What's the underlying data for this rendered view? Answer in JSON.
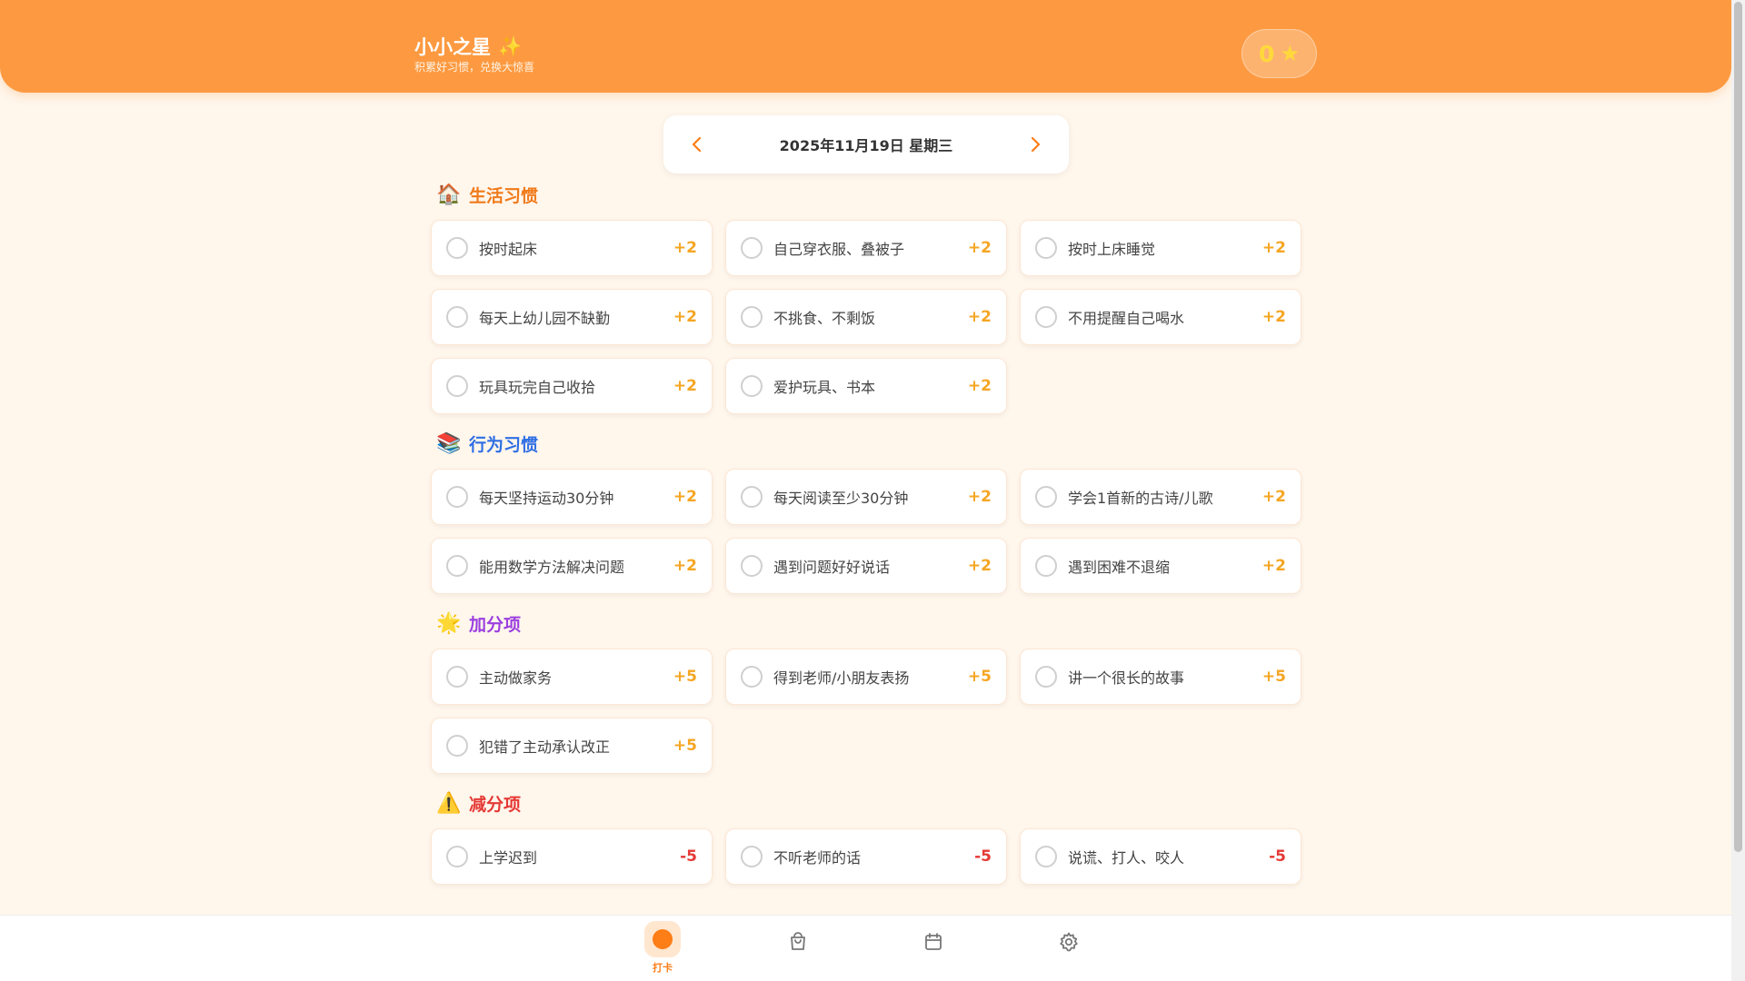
{
  "header": {
    "title": "小小之星",
    "title_icon": "sparkles-icon",
    "subtitle": "积累好习惯，兑换大惊喜",
    "score": "0",
    "score_icon": "star-icon"
  },
  "date_nav": {
    "date": "2025年11月19日 星期三",
    "prev_icon": "chevron-left-icon",
    "next_icon": "chevron-right-icon"
  },
  "sections": [
    {
      "key": "life",
      "icon": "🏠",
      "icon_name": "house-icon",
      "title": "生活习惯",
      "color": "#f07a1a",
      "items": [
        {
          "name": "按时起床",
          "points": "+2"
        },
        {
          "name": "自己穿衣服、叠被子",
          "points": "+2"
        },
        {
          "name": "按时上床睡觉",
          "points": "+2"
        },
        {
          "name": "每天上幼儿园不缺勤",
          "points": "+2"
        },
        {
          "name": "不挑食、不剩饭",
          "points": "+2"
        },
        {
          "name": "不用提醒自己喝水",
          "points": "+2"
        },
        {
          "name": "玩具玩完自己收拾",
          "points": "+2"
        },
        {
          "name": "爱护玩具、书本",
          "points": "+2"
        }
      ]
    },
    {
      "key": "behavior",
      "icon": "📚",
      "icon_name": "books-icon",
      "title": "行为习惯",
      "color": "#2f6fe4",
      "items": [
        {
          "name": "每天坚持运动30分钟",
          "points": "+2"
        },
        {
          "name": "每天阅读至少30分钟",
          "points": "+2"
        },
        {
          "name": "学会1首新的古诗/儿歌",
          "points": "+2"
        },
        {
          "name": "能用数学方法解决问题",
          "points": "+2"
        },
        {
          "name": "遇到问题好好说话",
          "points": "+2"
        },
        {
          "name": "遇到困难不退缩",
          "points": "+2"
        }
      ]
    },
    {
      "key": "bonus",
      "icon": "🌟",
      "icon_name": "glowing-star-icon",
      "title": "加分项",
      "color": "#9b3fe0",
      "items": [
        {
          "name": "主动做家务",
          "points": "+5"
        },
        {
          "name": "得到老师/小朋友表扬",
          "points": "+5"
        },
        {
          "name": "讲一个很长的故事",
          "points": "+5"
        },
        {
          "name": "犯错了主动承认改正",
          "points": "+5"
        }
      ]
    },
    {
      "key": "penalty",
      "icon": "⚠️",
      "icon_name": "warning-icon",
      "title": "减分项",
      "color": "#e53935",
      "items": [
        {
          "name": "上学迟到",
          "points": "-5"
        },
        {
          "name": "不听老师的话",
          "points": "-5"
        },
        {
          "name": "说谎、打人、咬人",
          "points": "-5"
        }
      ]
    }
  ],
  "bottom_nav": {
    "items": [
      {
        "name": "checkin",
        "label": "打卡",
        "icon": "checkin-dot-icon",
        "active": true
      },
      {
        "name": "shop",
        "label": "",
        "icon": "shopping-bag-icon",
        "active": false
      },
      {
        "name": "calendar",
        "label": "",
        "icon": "calendar-icon",
        "active": false
      },
      {
        "name": "settings",
        "label": "",
        "icon": "gear-icon",
        "active": false
      }
    ]
  },
  "colors": {
    "brand": "#fd9a41",
    "background": "#fff6ec",
    "plus_points": "#f5a623",
    "minus_points": "#e53935",
    "active_nav": "#fd7d16"
  }
}
